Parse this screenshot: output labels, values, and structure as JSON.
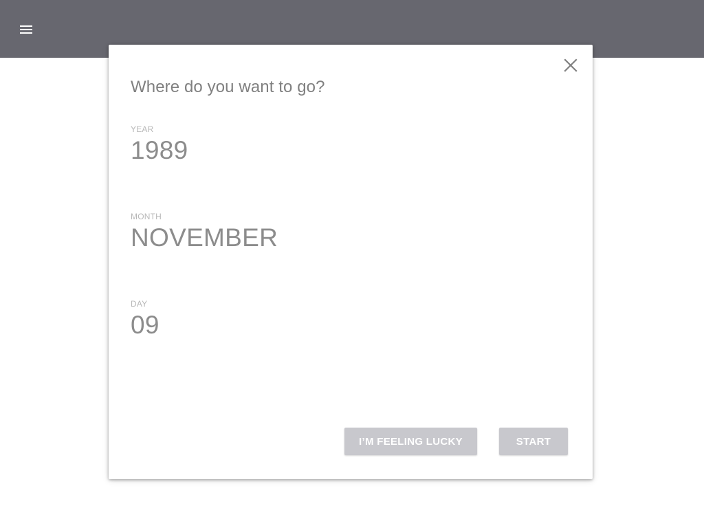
{
  "header": {
    "menu_icon": "menu-icon",
    "background_color": "#67676f"
  },
  "dialog": {
    "title": "Where do you want to go?",
    "close_icon": "close-icon",
    "fields": {
      "year": {
        "label": "YEAR",
        "value": "1989"
      },
      "month": {
        "label": "MONTH",
        "value": "NOVEMBER"
      },
      "day": {
        "label": "DAY",
        "value": "09"
      }
    },
    "buttons": {
      "lucky": "I’M FEELING LUCKY",
      "start": "START"
    },
    "button_color": "#c8c8cd"
  }
}
